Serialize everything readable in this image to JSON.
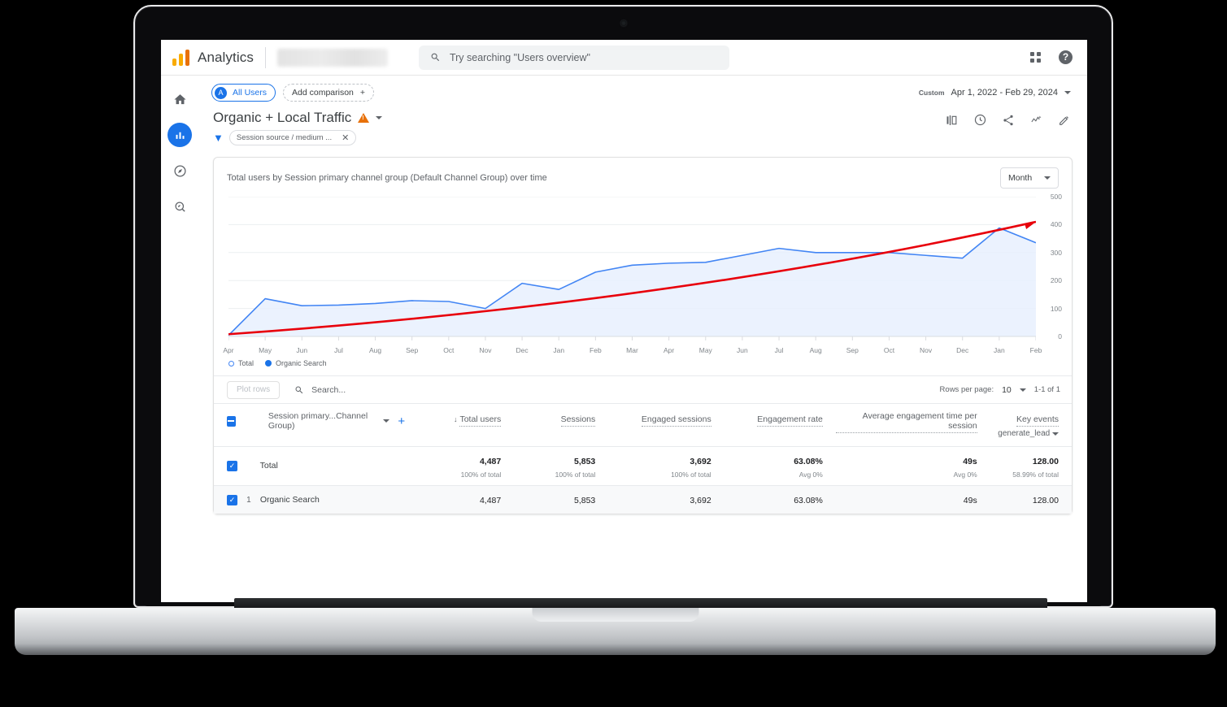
{
  "header": {
    "product_name": "Analytics",
    "search_placeholder": "Try searching \"Users overview\"",
    "apps_icon": "apps-grid-icon",
    "help_icon": "help-icon",
    "help_glyph": "?"
  },
  "rail": {
    "items": [
      {
        "name": "home",
        "icon": "home-icon",
        "active": false
      },
      {
        "name": "reports",
        "icon": "reports-bar-chart-icon",
        "active": true
      },
      {
        "name": "explore",
        "icon": "explore-compass-icon",
        "active": false
      },
      {
        "name": "advertising",
        "icon": "advertising-magnifier-icon",
        "active": false
      }
    ]
  },
  "topbar": {
    "audience_chip": "All Users",
    "audience_initial": "A",
    "add_comparison": "Add comparison",
    "add_comparison_glyph": "+",
    "date_label": "Custom",
    "date_range": "Apr 1, 2022 - Feb 29, 2024"
  },
  "report": {
    "title": "Organic + Local Traffic",
    "warning_icon": "warning-triangle-icon",
    "filter_chip": "Session source / medium ...",
    "filter_icon": "filter-funnel-icon",
    "close_glyph": "✕",
    "actions": [
      {
        "name": "compare-icon",
        "label": "Compare"
      },
      {
        "name": "history-clock-icon",
        "label": "History"
      },
      {
        "name": "share-icon",
        "label": "Share"
      },
      {
        "name": "insights-icon",
        "label": "Insights"
      },
      {
        "name": "edit-pencil-icon",
        "label": "Edit"
      }
    ]
  },
  "chart_card": {
    "title": "Total users by Session primary channel group (Default Channel Group) over time",
    "granularity": "Month"
  },
  "chart_data": {
    "type": "line",
    "title": "Total users by Session primary channel group (Default Channel Group) over time",
    "xlabel": "",
    "ylabel": "",
    "ylim": [
      0,
      500
    ],
    "yticks": [
      0,
      100,
      200,
      300,
      400,
      500
    ],
    "grid": true,
    "legend_position": "bottom-left",
    "legend": [
      {
        "name": "Total",
        "marker": "hollow-circle",
        "color": "#4285f4"
      },
      {
        "name": "Organic Search",
        "marker": "filled-circle",
        "color": "#1a73e8"
      }
    ],
    "categories": [
      "Apr",
      "May",
      "Jun",
      "Jul",
      "Aug",
      "Sep",
      "Oct",
      "Nov",
      "Dec",
      "Jan",
      "Feb",
      "Mar",
      "Apr",
      "May",
      "Jun",
      "Jul",
      "Aug",
      "Sep",
      "Oct",
      "Nov",
      "Dec",
      "Jan",
      "Feb"
    ],
    "series": [
      {
        "name": "Organic Search",
        "color": "#4285f4",
        "values": [
          4,
          135,
          110,
          112,
          118,
          128,
          125,
          100,
          190,
          168,
          230,
          255,
          262,
          265,
          290,
          315,
          300,
          300,
          300,
          290,
          280,
          388,
          335
        ]
      },
      {
        "name": "Trendline",
        "color": "#e8000b",
        "type": "trend-arrow",
        "values": [
          8,
          410
        ]
      }
    ]
  },
  "table": {
    "plot_rows_label": "Plot rows",
    "search_placeholder": "Search...",
    "search_icon": "search-icon",
    "rows_per_page_label": "Rows per page:",
    "rows_per_page_value": "10",
    "pagination": "1-1 of 1",
    "dimension_header": "Session primary...Channel Group)",
    "add_dimension_glyph": "+",
    "columns": [
      {
        "label": "Total users",
        "sorted": true,
        "sort_glyph": "↓"
      },
      {
        "label": "Sessions",
        "sorted": false
      },
      {
        "label": "Engaged sessions",
        "sorted": false
      },
      {
        "label": "Engagement rate",
        "sorted": false
      },
      {
        "label": "Average engagement time per session",
        "sorted": false
      },
      {
        "label": "Key events",
        "sub": "generate_lead",
        "sorted": false
      }
    ],
    "rows": [
      {
        "index": "",
        "name": "Total",
        "checked": true,
        "is_total": true,
        "values": [
          {
            "value": "4,487",
            "sub": "100% of total"
          },
          {
            "value": "5,853",
            "sub": "100% of total"
          },
          {
            "value": "3,692",
            "sub": "100% of total"
          },
          {
            "value": "63.08%",
            "sub": "Avg 0%"
          },
          {
            "value": "49s",
            "sub": "Avg 0%"
          },
          {
            "value": "128.00",
            "sub": "58.99% of total"
          }
        ]
      },
      {
        "index": "1",
        "name": "Organic Search",
        "checked": true,
        "is_total": false,
        "values": [
          {
            "value": "4,487",
            "sub": ""
          },
          {
            "value": "5,853",
            "sub": ""
          },
          {
            "value": "3,692",
            "sub": ""
          },
          {
            "value": "63.08%",
            "sub": ""
          },
          {
            "value": "49s",
            "sub": ""
          },
          {
            "value": "128.00",
            "sub": ""
          }
        ]
      }
    ]
  },
  "colors": {
    "brand_orange": "#f9ab00",
    "brand_orange_dark": "#e8710a",
    "accent_blue": "#1a73e8",
    "line_blue": "#4285f4",
    "area_blue": "#e8f0fe",
    "trend_red": "#e8000b"
  }
}
